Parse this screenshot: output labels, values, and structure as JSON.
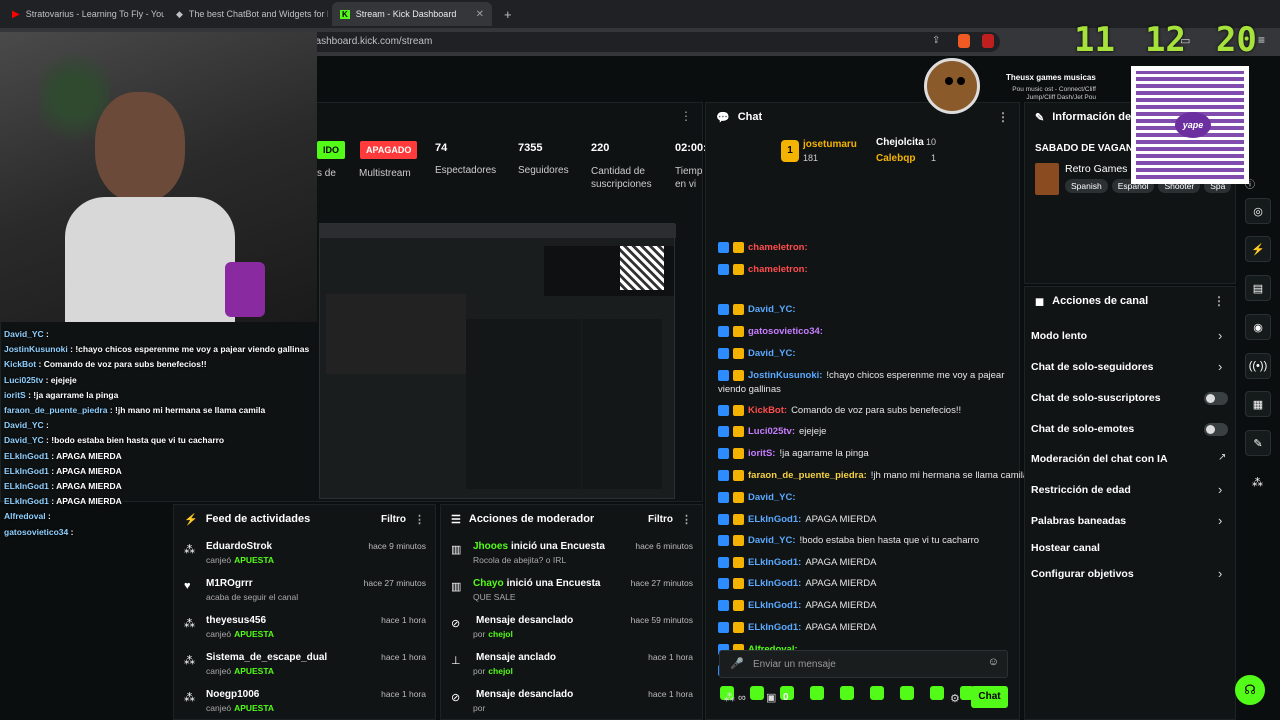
{
  "browser": {
    "tabs": [
      {
        "label": "Stratovarius - Learning To Fly - YouTube"
      },
      {
        "label": "The best ChatBot and Widgets for Kick"
      },
      {
        "label": "Stream - Kick Dashboard"
      }
    ],
    "url": "dashboard.kick.com/stream"
  },
  "overlay": {
    "clock": [
      "11",
      "12",
      "20"
    ],
    "now_playing_title": "Theusx games musicas",
    "now_playing_sub": "Pou music ost - Connect/Cliff Jump/Cliff Dash/Jet Pou",
    "qr_brand": "yape",
    "chat": [
      {
        "user": "David_YC",
        "msg": ""
      },
      {
        "user": "JostinKusunoki",
        "msg": "!chayo chicos esperenme me voy a pajear viendo gallinas"
      },
      {
        "user": "KickBot",
        "msg": "Comando de voz para subs benefecios!!"
      },
      {
        "user": "Luci025tv",
        "msg": "ejejeje"
      },
      {
        "user": "ioritS",
        "msg": "!ja agarrame la pinga"
      },
      {
        "user": "faraon_de_puente_piedra",
        "msg": "!jh mano mi hermana se llama camila"
      },
      {
        "user": "David_YC",
        "msg": ""
      },
      {
        "user": "David_YC",
        "msg": "!bodo estaba bien hasta que vi tu cacharro"
      },
      {
        "user": "ELkInGod1",
        "msg": "APAGA MIERDA"
      },
      {
        "user": "ELkInGod1",
        "msg": "APAGA MIERDA"
      },
      {
        "user": "ELkInGod1",
        "msg": "APAGA MIERDA"
      },
      {
        "user": "ELkInGod1",
        "msg": "APAGA MIERDA"
      },
      {
        "user": "Alfredoval",
        "msg": ""
      },
      {
        "user": "gatosovietico34",
        "msg": ""
      }
    ]
  },
  "stats": {
    "status_badge": "IDO",
    "multistream_badge": "APAGADO",
    "multistream_label": "Multistream",
    "partial_label": "s de",
    "viewers": {
      "value": "74",
      "label": "Espectadores"
    },
    "followers": {
      "value": "7355",
      "label": "Seguidores"
    },
    "subs": {
      "value": "220",
      "label": "Cantidad de suscripciones"
    },
    "time": {
      "value": "02:00:",
      "label": "Tiemp en vi"
    }
  },
  "feed": {
    "title": "Feed de actividades",
    "filter": "Filtro",
    "items": [
      {
        "name": "EduardoStrok",
        "sub": "canjeó",
        "hl": "APUESTA",
        "time": "hace 9 minutos",
        "icon": "gift-icon"
      },
      {
        "name": "M1ROgrrr",
        "sub": "acaba de seguir el canal",
        "hl": "",
        "time": "hace 27 minutos",
        "icon": "heart-icon"
      },
      {
        "name": "theyesus456",
        "sub": "canjeó",
        "hl": "APUESTA",
        "time": "hace 1 hora",
        "icon": "gift-icon"
      },
      {
        "name": "Sistema_de_escape_dual",
        "sub": "canjeó",
        "hl": "APUESTA",
        "time": "hace 1 hora",
        "icon": "gift-icon"
      },
      {
        "name": "Noegp1006",
        "sub": "canjeó",
        "hl": "APUESTA",
        "time": "hace 1 hora",
        "icon": "gift-icon"
      }
    ]
  },
  "mod": {
    "title": "Acciones de moderador",
    "filter": "Filtro",
    "items": [
      {
        "actor": "Jhooes",
        "action": "inició una Encuesta",
        "sub": "Rocola de abejita? o IRL",
        "by": "",
        "time": "hace 6 minutos",
        "icon": "poll-icon"
      },
      {
        "actor": "Chayo",
        "action": "inició una Encuesta",
        "sub": "QUE SALE",
        "by": "",
        "time": "hace 27 minutos",
        "icon": "poll-icon"
      },
      {
        "actor": "",
        "action": "Mensaje desanclado",
        "sub": "por",
        "by": "chejol",
        "time": "hace 59 minutos",
        "icon": "unpin-icon"
      },
      {
        "actor": "",
        "action": "Mensaje anclado",
        "sub": "por",
        "by": "chejol",
        "time": "hace 1 hora",
        "icon": "pin-icon"
      },
      {
        "actor": "",
        "action": "Mensaje desanclado",
        "sub": "por",
        "by": "",
        "time": "hace 1 hora",
        "icon": "unpin-icon"
      }
    ]
  },
  "chat": {
    "title": "Chat",
    "top": [
      {
        "rank": "1",
        "user": "josetumaru",
        "count": "181"
      },
      {
        "user": "Chejolcita",
        "count": "10"
      },
      {
        "user": "Calebqp",
        "count": "1"
      }
    ],
    "messages": [
      {
        "user": "chameletron",
        "msg": "",
        "color": "#ff4d4d"
      },
      {
        "user": "chameletron",
        "msg": "",
        "color": "#ff4d4d"
      },
      {
        "user": "David_YC",
        "msg": "",
        "color": "#5aa9ff"
      },
      {
        "user": "gatosovietico34",
        "msg": "",
        "color": "#c77dff"
      },
      {
        "user": "David_YC",
        "msg": "",
        "color": "#5aa9ff"
      },
      {
        "user": "JostinKusunoki",
        "msg": "!chayo chicos esperenme me voy a pajear",
        "cont": "viendo gallinas",
        "color": "#5aa9ff"
      },
      {
        "user": "KickBot",
        "msg": "Comando de voz para subs benefecios!!",
        "color": "#ff4d4d"
      },
      {
        "user": "Luci025tv",
        "msg": "ejejeje",
        "color": "#c77dff"
      },
      {
        "user": "ioritS",
        "msg": "!ja agarrame la pinga",
        "color": "#c77dff"
      },
      {
        "user": "faraon_de_puente_piedra",
        "msg": "!jh mano mi hermana se llama camila",
        "color": "#f5d142"
      },
      {
        "user": "David_YC",
        "msg": "",
        "color": "#5aa9ff"
      },
      {
        "user": "ELkInGod1",
        "msg": "APAGA MIERDA",
        "color": "#5aa9ff"
      },
      {
        "user": "David_YC",
        "msg": "!bodo estaba bien hasta que vi tu cacharro",
        "color": "#5aa9ff"
      },
      {
        "user": "ELkInGod1",
        "msg": "APAGA MIERDA",
        "color": "#5aa9ff"
      },
      {
        "user": "ELkInGod1",
        "msg": "APAGA MIERDA",
        "color": "#5aa9ff"
      },
      {
        "user": "ELkInGod1",
        "msg": "APAGA MIERDA",
        "color": "#5aa9ff"
      },
      {
        "user": "ELkInGod1",
        "msg": "APAGA MIERDA",
        "color": "#5aa9ff"
      },
      {
        "user": "Alfredoval",
        "msg": "",
        "color": "#53fc18"
      },
      {
        "user": "gatosovietico34",
        "msg": "",
        "color": "#c77dff"
      }
    ],
    "input_placeholder": "Enviar un mensaje",
    "points": "0",
    "send": "Chat"
  },
  "info": {
    "title": "Información del str",
    "stream_title": "SABADO DE VAGANC",
    "category": "Retro Games",
    "tags": [
      "Spanish",
      "Español",
      "Shooter",
      "Spa"
    ]
  },
  "actions": {
    "title": "Acciones de canal",
    "items": [
      {
        "label": "Modo lento",
        "ctl": "chevron"
      },
      {
        "label": "Chat de solo-seguidores",
        "ctl": "chevron"
      },
      {
        "label": "Chat de solo-suscriptores",
        "ctl": "toggle"
      },
      {
        "label": "Chat de solo-emotes",
        "ctl": "toggle"
      },
      {
        "label": "Moderación del chat con IA",
        "ctl": "ext"
      },
      {
        "label": "Restricción de edad",
        "ctl": "chevron"
      },
      {
        "label": "Palabras baneadas",
        "ctl": "chevron"
      },
      {
        "label": "Hostear canal",
        "ctl": ""
      },
      {
        "label": "Configurar objetivos",
        "ctl": "chevron"
      }
    ]
  },
  "colors": {
    "accent": "#53fc18",
    "danger": "#ff3b3b",
    "panel": "#111415"
  }
}
